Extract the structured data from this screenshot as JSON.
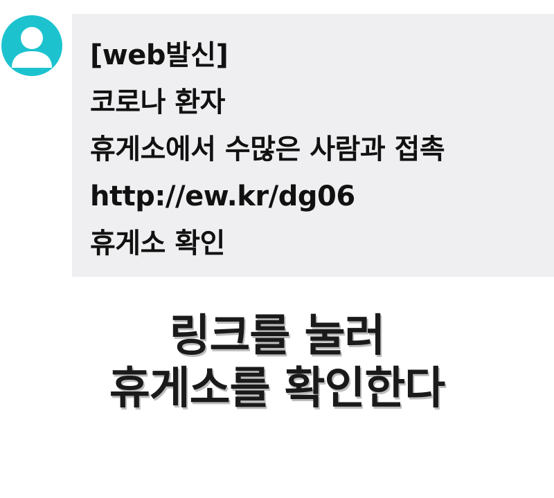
{
  "colors": {
    "avatar_bg": "#1cc3cf",
    "bubble_bg": "#efeff1",
    "text": "#111111"
  },
  "sender": {
    "avatar_icon": "person-icon"
  },
  "message": {
    "lines": [
      "[web발신]",
      "코로나 환자",
      "휴게소에서 수많은 사람과 접촉",
      "http://ew.kr/dg06",
      "휴게소 확인"
    ]
  },
  "caption": {
    "lines": [
      "링크를 눌러",
      "휴게소를 확인한다"
    ]
  }
}
